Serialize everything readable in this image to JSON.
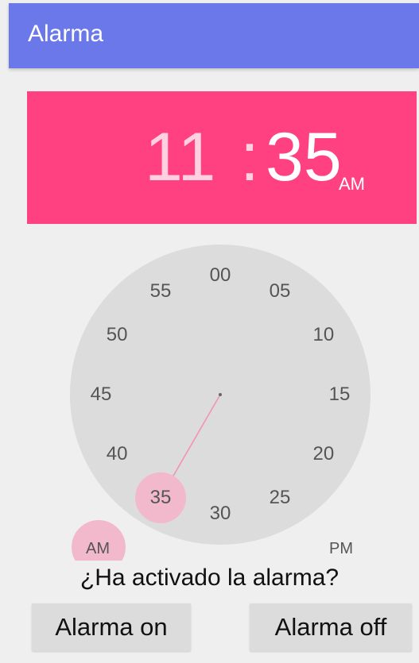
{
  "appbar": {
    "title": "Alarma",
    "color": "#6b78ea"
  },
  "time_header": {
    "hour": "11",
    "colon": ":",
    "minute": "35",
    "ampm": "AM",
    "color": "#ff4081"
  },
  "clock": {
    "selected_minute": "35",
    "minute_labels": [
      "00",
      "05",
      "10",
      "15",
      "20",
      "25",
      "30",
      "35",
      "40",
      "45",
      "50",
      "55"
    ],
    "accent": "#ff4081",
    "face_color": "#dcdcdc"
  },
  "ampm": {
    "am": "AM",
    "pm": "PM",
    "selected": "AM"
  },
  "question": "¿Ha activado la alarma?",
  "buttons": {
    "on": "Alarma on",
    "off": "Alarma off"
  }
}
